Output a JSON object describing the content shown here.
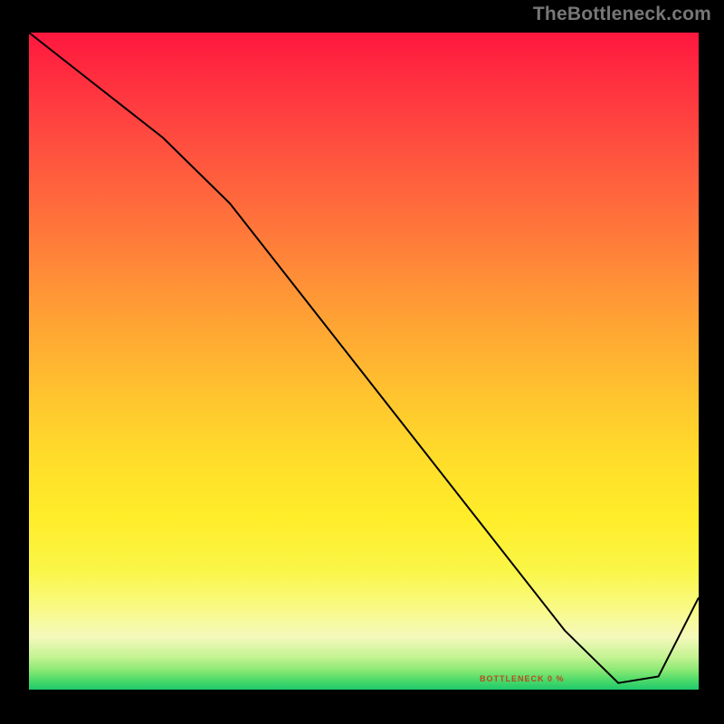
{
  "watermark": "TheBottleneck.com",
  "bottleneck_label": "BOTTLENECK 0 %",
  "chart_data": {
    "type": "line",
    "title": "",
    "xlabel": "",
    "ylabel": "",
    "xlim": [
      0,
      100
    ],
    "ylim": [
      0,
      100
    ],
    "series": [
      {
        "name": "bottleneck-curve",
        "x": [
          0,
          10,
          20,
          30,
          40,
          50,
          60,
          70,
          80,
          88,
          94,
          100
        ],
        "y": [
          100,
          92,
          84,
          74,
          61,
          48,
          35,
          22,
          9,
          1,
          2,
          14
        ]
      }
    ],
    "minimum_band_x": [
      80,
      88
    ],
    "minimum_label_x": 70,
    "minimum_label_y": 1.5,
    "colors": {
      "line": "#000000",
      "label": "#b94b1c"
    }
  }
}
